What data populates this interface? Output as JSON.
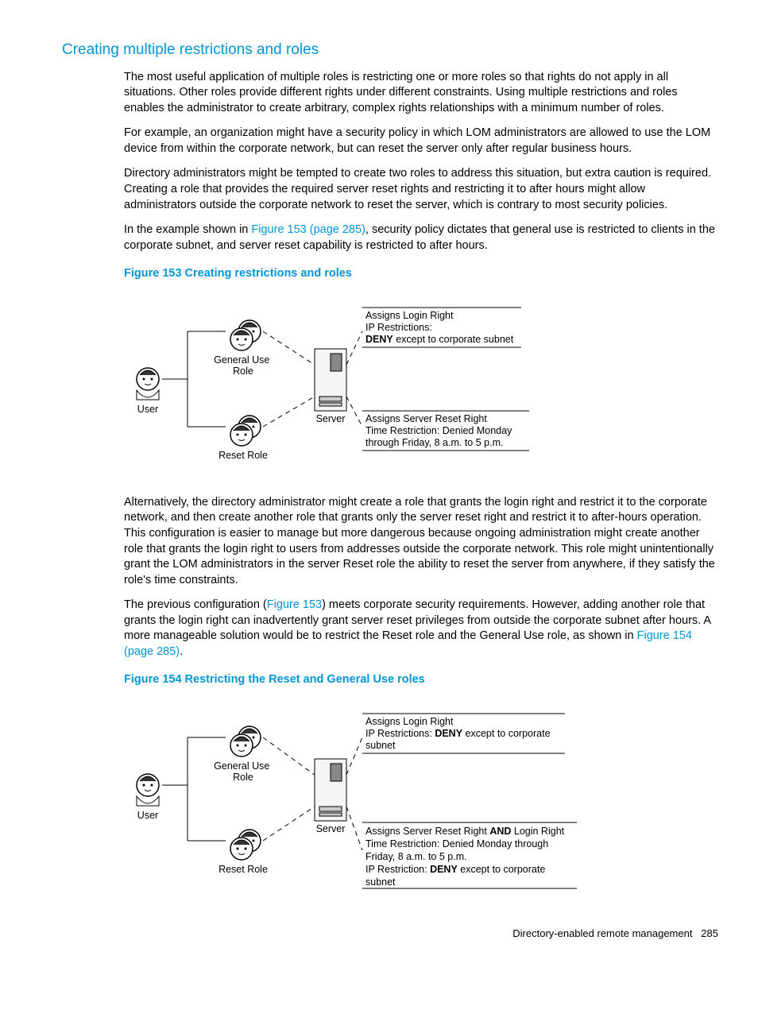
{
  "heading": "Creating multiple restrictions and roles",
  "para1": "The most useful application of multiple roles is restricting one or more roles so that rights do not apply in all situations. Other roles provide different rights under different constraints. Using multiple restrictions and roles enables the administrator to create arbitrary, complex rights relationships with a minimum number of roles.",
  "para2": "For example, an organization might have a security policy in which LOM administrators are allowed to use the LOM device from within the corporate network, but can reset the server only after regular business hours.",
  "para3": "Directory administrators might be tempted to create two roles to address this situation, but extra caution is required. Creating a role that provides the required server reset rights and restricting it to after hours might allow administrators outside the corporate network to reset the server, which is contrary to most security policies.",
  "para4_a": "In the example shown in ",
  "para4_link": "Figure 153 (page 285)",
  "para4_b": ", security policy dictates that general use is restricted to clients in the corporate subnet, and server reset capability is restricted to after hours.",
  "fig153_caption": "Figure 153 Creating restrictions and roles",
  "fig153": {
    "user": "User",
    "general_role": "General Use\nRole",
    "reset_role": "Reset Role",
    "server": "Server",
    "box1_l1": "Assigns Login Right",
    "box1_l2": "IP Restrictions:",
    "box1_l3a": "DENY",
    "box1_l3b": " except to corporate subnet",
    "box2_l1": "Assigns Server Reset Right",
    "box2_l2": "Time Restriction:  Denied Monday",
    "box2_l3": "through Friday, 8 a.m. to 5 p.m."
  },
  "para5": "Alternatively, the directory administrator might create a role that grants the login right and restrict it to the corporate network, and then create another role that grants only the server reset right and restrict it to after-hours operation. This configuration is easier to manage but more dangerous because ongoing administration might create another role that grants the login right to users from addresses outside the corporate network. This role might unintentionally grant the LOM administrators in the server Reset role the ability to reset the server from anywhere, if they satisfy the role's time constraints.",
  "para6_a": "The previous configuration (",
  "para6_link1": "Figure 153",
  "para6_b": ") meets corporate security requirements. However, adding another role that grants the login right can inadvertently grant server reset privileges from outside the corporate subnet after hours. A more manageable solution would be to restrict the Reset role and the General Use role, as shown in ",
  "para6_link2": "Figure 154 (page 285)",
  "para6_c": ".",
  "fig154_caption": "Figure 154 Restricting the Reset and General Use roles",
  "fig154": {
    "user": "User",
    "general_role": "General Use\nRole",
    "reset_role": "Reset Role",
    "server": "Server",
    "box1_l1": "Assigns Login Right",
    "box1_l2a": "IP Restrictions:  ",
    "box1_l2b": "DENY",
    "box1_l2c": " except to corporate",
    "box1_l3": "subnet",
    "box2_l1a": "Assigns Server Reset Right ",
    "box2_l1b": "AND",
    "box2_l1c": " Login Right",
    "box2_l2": "Time Restriction:  Denied Monday through",
    "box2_l3": "Friday, 8 a.m. to 5 p.m.",
    "box2_l4a": "IP Restriction:  ",
    "box2_l4b": "DENY",
    "box2_l4c": " except to corporate",
    "box2_l5": "subnet"
  },
  "footer_text": "Directory-enabled remote management",
  "footer_page": "285"
}
